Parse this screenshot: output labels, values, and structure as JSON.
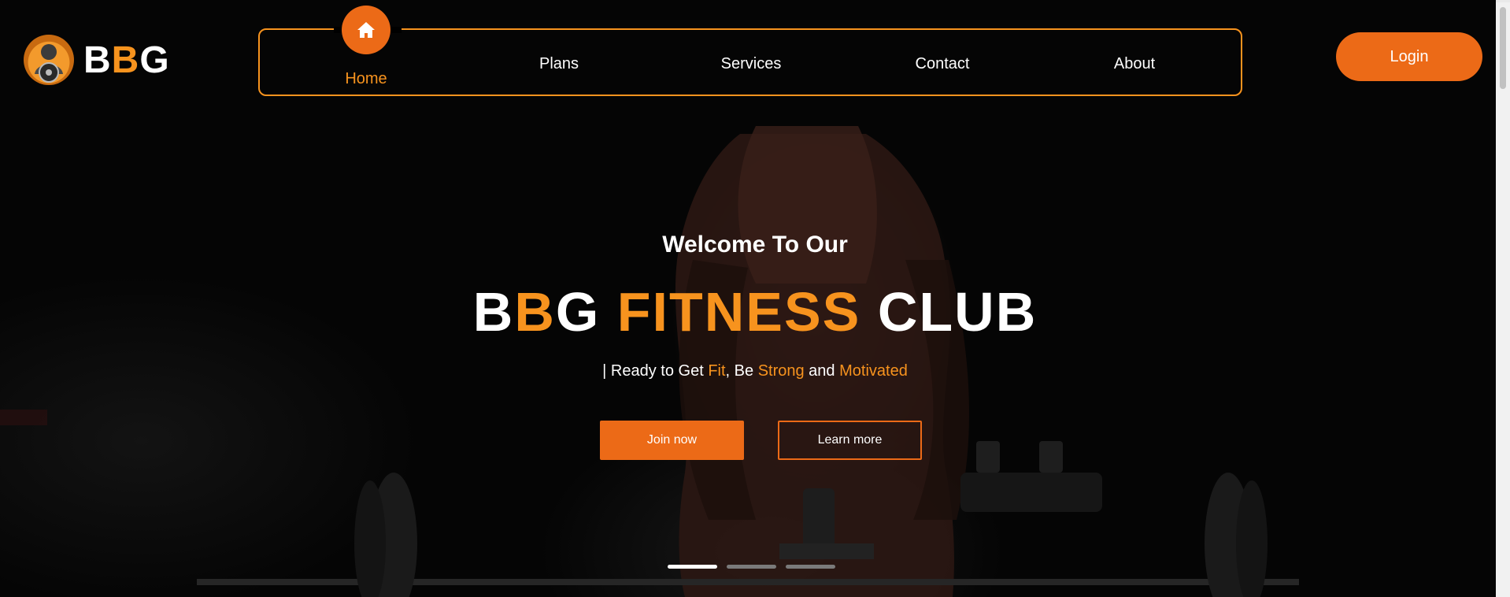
{
  "brand": {
    "logo_prefix": "B",
    "logo_accent": "B",
    "logo_suffix": "G",
    "emblem": "gym-mascot-emblem"
  },
  "nav": {
    "items": [
      {
        "label": "Home",
        "icon": "home-icon",
        "active": true
      },
      {
        "label": "Plans"
      },
      {
        "label": "Services"
      },
      {
        "label": "Contact"
      },
      {
        "label": "About"
      }
    ]
  },
  "header": {
    "login_label": "Login"
  },
  "hero": {
    "welcome": "Welcome To Our",
    "title_part1": "B",
    "title_part2": "BG",
    "title_part3": "G",
    "title_fitness": "FITNESS",
    "title_club": "CLUB",
    "tagline_prefix": "| Ready to Get ",
    "tagline_fit": "Fit",
    "tagline_mid1": ", Be ",
    "tagline_strong": "Strong",
    "tagline_mid2": " and ",
    "tagline_motivated": "Motivated",
    "join_label": "Join now",
    "learn_label": "Learn more",
    "slides": 3,
    "active_slide": 1
  },
  "colors": {
    "accent": "#ec6a17",
    "accent_light": "#f7931e",
    "background": "#000000",
    "text": "#ffffff"
  }
}
